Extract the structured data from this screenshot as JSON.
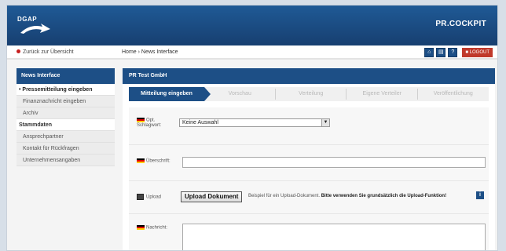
{
  "header": {
    "logo": "DGAP",
    "brand": "PR.COCKPIT"
  },
  "subbar": {
    "back_label": "Zurück zur Übersicht",
    "breadcrumb": "Home › News Interface",
    "logout_label": "LOGOUT"
  },
  "sidebar": {
    "title": "News Interface",
    "items": [
      {
        "label": "• Pressemitteilung eingeben",
        "active": true
      },
      {
        "label": "Finanznachricht eingeben"
      },
      {
        "label": "Archiv"
      }
    ],
    "section_title": "Stammdaten",
    "section_items": [
      {
        "label": "Ansprechpartner"
      },
      {
        "label": "Kontakt für Rückfragen"
      },
      {
        "label": "Unternehmensangaben"
      }
    ]
  },
  "main": {
    "title": "PR Test GmbH",
    "steps": [
      "Mitteilung eingeben",
      "Vorschau",
      "Verteilung",
      "Eigene Verteiler",
      "Veröffentlichung"
    ],
    "fields": {
      "keyword_label": "Opt. Schlagwort:",
      "keyword_value": "Keine Auswahl",
      "headline_label": "Überschrift:",
      "upload_label": "Upload",
      "upload_button": "Upload Dokument",
      "upload_note_prefix": "Beispiel für ein Upload-Dokument.",
      "upload_note_bold": "Bitte verwenden Sie grundsätzlich die Upload-Funktion!",
      "message_label": "Nachricht:"
    }
  },
  "colors": {
    "primary": "#1d4f86",
    "logout": "#c0392b"
  }
}
